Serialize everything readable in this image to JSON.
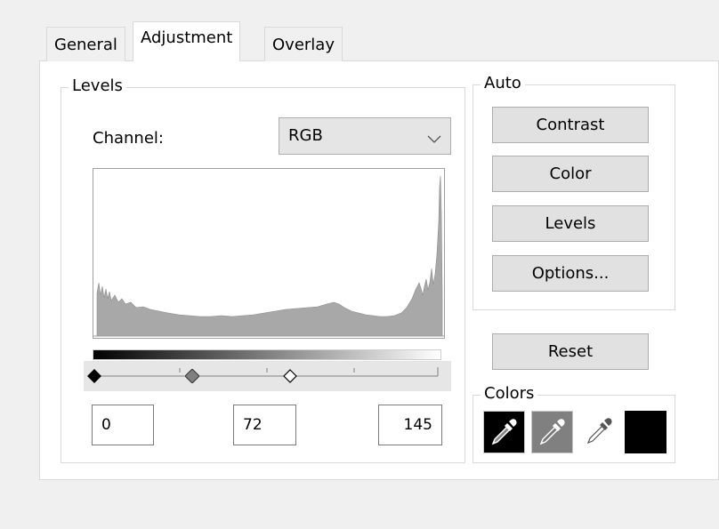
{
  "tabs": [
    {
      "label": "General",
      "active": false
    },
    {
      "label": "Adjustment",
      "active": true
    },
    {
      "label": "Overlay",
      "active": false
    }
  ],
  "levels": {
    "group_title": "Levels",
    "channel_label": "Channel:",
    "channel_value": "RGB",
    "input_values": {
      "black": "0",
      "gray": "72",
      "white": "145"
    },
    "slider_levels": {
      "black": 0,
      "gray": 72,
      "white": 145,
      "max": 255
    }
  },
  "auto": {
    "group_title": "Auto",
    "buttons": {
      "contrast": "Contrast",
      "color": "Color",
      "levels": "Levels",
      "options": "Options..."
    }
  },
  "reset_label": "Reset",
  "colors": {
    "group_title": "Colors",
    "black_swatch": "#000000",
    "gray_swatch": "#808080",
    "color_swatch": "#000000"
  },
  "icons": {
    "black_picker": "eyedropper-icon",
    "gray_picker": "eyedropper-icon",
    "white_picker": "eyedropper-icon",
    "channel_dropdown": "chevron-down-icon"
  }
}
